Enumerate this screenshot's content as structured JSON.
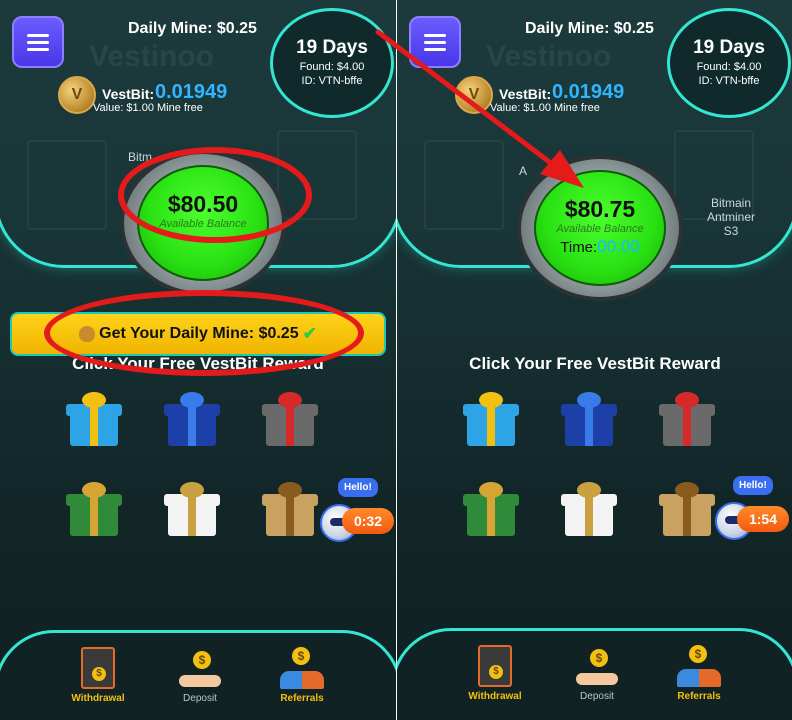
{
  "colors": {
    "accent": "#32e6d2",
    "balance_green": "#28e012",
    "highlight_red": "#e51b1b",
    "button_yellow": "#f0b400",
    "vestbit_blue": "#2fb6ff"
  },
  "left": {
    "daily_mine": "Daily Mine: $0.25",
    "days": "19 Days",
    "found": "Found: $4.00",
    "id": "ID: VTN-bffe",
    "vestbit_label": "VestBit:",
    "vestbit_value": "0.01949",
    "value_line": "Value: $1.00 Mine free",
    "side_left": "Bitm",
    "balance": "$80.50",
    "balance_label": "Available Balance",
    "daily_button": "Get Your Daily Mine: $0.25",
    "reward_title": "Click Your Free VestBit Reward",
    "bot_hello": "Hello!",
    "bot_timer": "0:32"
  },
  "right": {
    "daily_mine": "Daily Mine: $0.25",
    "days": "19 Days",
    "found": "Found: $4.00",
    "id": "ID: VTN-bffe",
    "vestbit_label": "VestBit:",
    "vestbit_value": "0.01949",
    "value_line": "Value: $1.00 Mine free",
    "side_left": "A",
    "side_right": "Bitmain\nAntminer\nS3",
    "balance": "$80.75",
    "balance_label": "Available Balance",
    "time_label": "Time:",
    "time_value": "00:00",
    "reward_title": "Click Your Free VestBit Reward",
    "bot_hello": "Hello!",
    "bot_timer": "1:54"
  },
  "background_word": "Vestinoo",
  "coin_letter": "V",
  "nav": {
    "withdrawal": "Withdrawal",
    "deposit": "Deposit",
    "referrals": "Referrals"
  },
  "icons": [
    "hamburger-menu-icon",
    "vestbit-coin-icon",
    "money-bag-icon",
    "check-mark-icon",
    "gift-box-icon",
    "chat-bot-icon",
    "withdrawal-icon",
    "deposit-icon",
    "referrals-icon",
    "red-arrow"
  ]
}
